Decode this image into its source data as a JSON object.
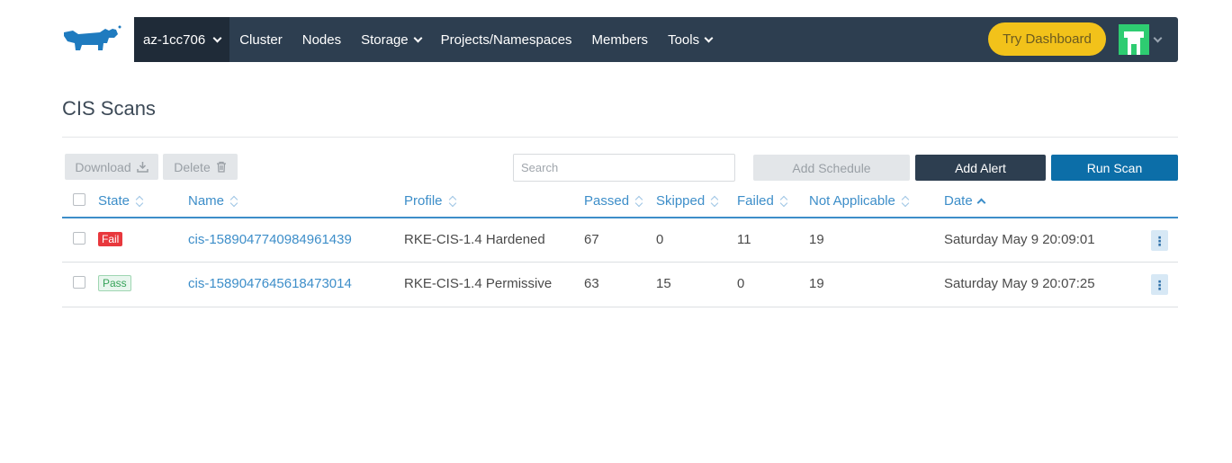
{
  "header": {
    "cluster": "az-1cc706",
    "nav": [
      {
        "label": "Cluster",
        "dropdown": false
      },
      {
        "label": "Nodes",
        "dropdown": false
      },
      {
        "label": "Storage",
        "dropdown": true
      },
      {
        "label": "Projects/Namespaces",
        "dropdown": false
      },
      {
        "label": "Members",
        "dropdown": false
      },
      {
        "label": "Tools",
        "dropdown": true
      }
    ],
    "try_dashboard": "Try Dashboard",
    "colors": {
      "bar": "#2d3e50",
      "cluster_bg": "#1f2b38",
      "try_dashboard": "#f2c21a",
      "avatar": "#2ecc71"
    }
  },
  "page": {
    "title": "CIS Scans"
  },
  "toolbar": {
    "download": "Download",
    "delete": "Delete",
    "search_placeholder": "Search",
    "add_schedule": "Add Schedule",
    "add_alert": "Add Alert",
    "run_scan": "Run Scan"
  },
  "table": {
    "columns": [
      "State",
      "Name",
      "Profile",
      "Passed",
      "Skipped",
      "Failed",
      "Not Applicable",
      "Date"
    ],
    "rows": [
      {
        "state": "Fail",
        "name": "cis-1589047740984961439",
        "profile": "RKE-CIS-1.4 Hardened",
        "passed": "67",
        "skipped": "0",
        "failed": "11",
        "not_applicable": "19",
        "date": "Saturday May 9 20:09:01"
      },
      {
        "state": "Pass",
        "name": "cis-1589047645618473014",
        "profile": "RKE-CIS-1.4 Permissive",
        "passed": "63",
        "skipped": "15",
        "failed": "0",
        "not_applicable": "19",
        "date": "Saturday May 9 20:07:25"
      }
    ]
  },
  "icons": {
    "logo": "rancher-logo",
    "download": "download-icon",
    "delete": "trash-icon",
    "row_menu": "kebab-icon"
  }
}
